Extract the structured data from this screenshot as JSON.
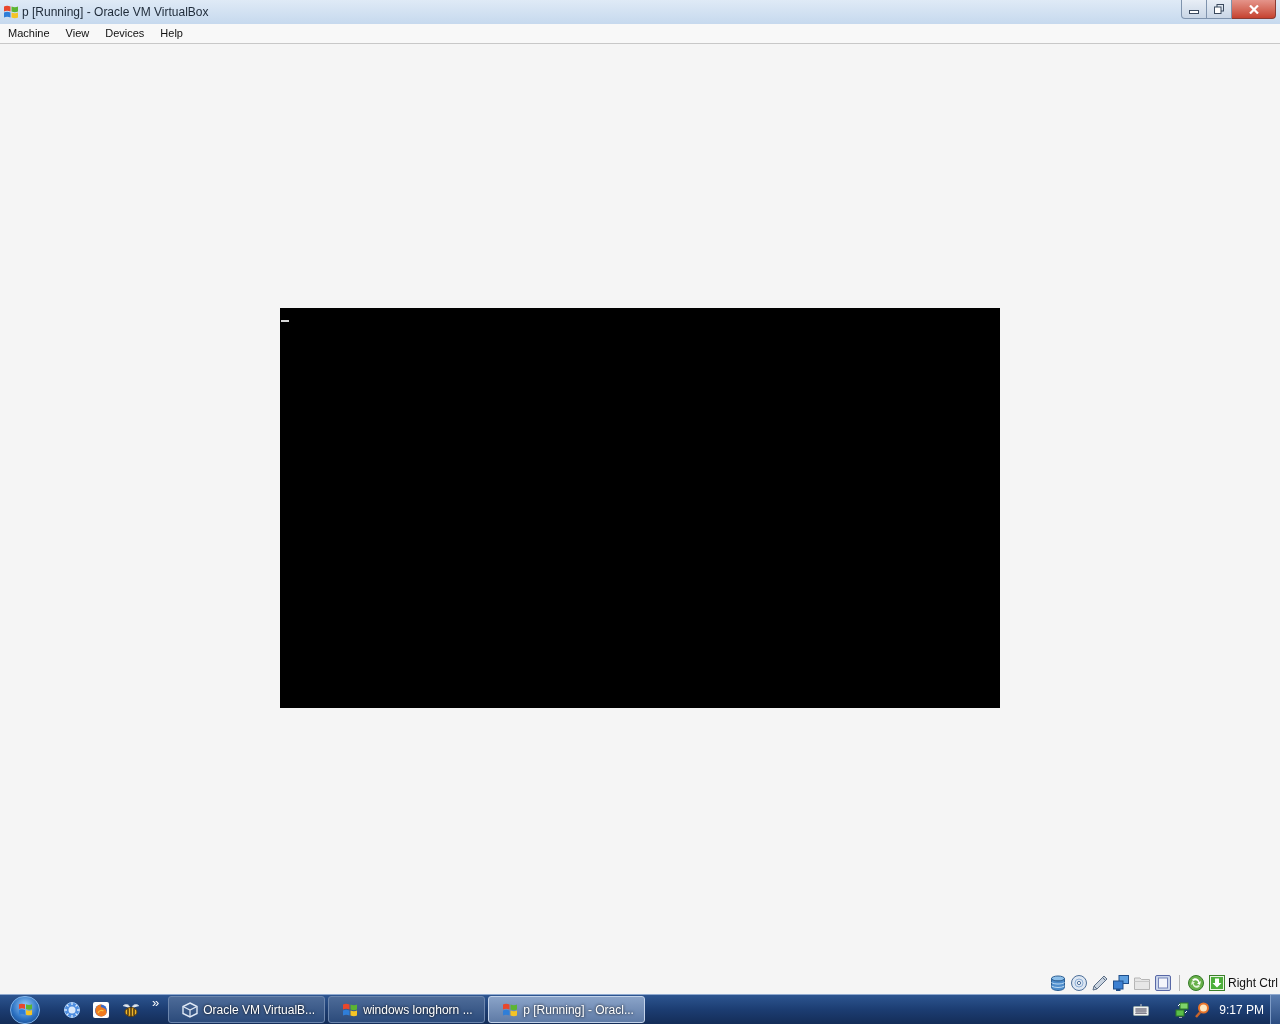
{
  "window": {
    "title": "p [Running] - Oracle VM VirtualBox"
  },
  "menu_bar": [
    "Machine",
    "View",
    "Devices",
    "Help"
  ],
  "status_bar": {
    "host_key": "Right Ctrl"
  },
  "taskbar": {
    "overflow": "»",
    "tasks": [
      {
        "label": "Oracle VM VirtualB...",
        "kind": "manager",
        "selected": false
      },
      {
        "label": "windows longhorn ...",
        "kind": "vm",
        "selected": false
      },
      {
        "label": "p [Running] - Oracl...",
        "kind": "vm",
        "selected": true
      }
    ],
    "clock": "9:17 PM"
  }
}
